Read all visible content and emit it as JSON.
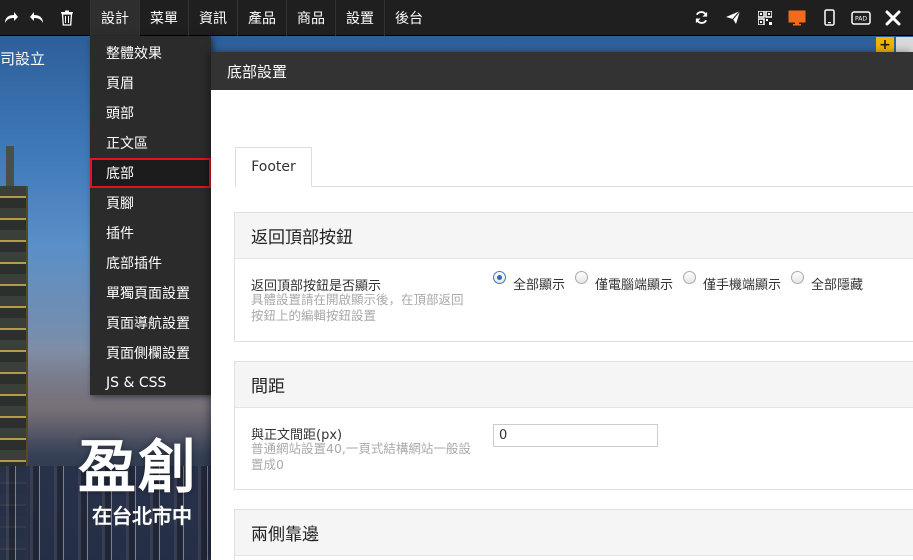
{
  "toolbar": {
    "left_icons": [
      "redo-icon",
      "undo-icon",
      "trash-icon"
    ],
    "menu": [
      "設計",
      "菜單",
      "資訊",
      "產品",
      "商品",
      "設置",
      "後台"
    ],
    "right_icons": [
      "refresh-icon",
      "send-icon",
      "qrcode-icon",
      "desktop-icon",
      "mobile-icon",
      "pad-icon",
      "close-icon"
    ],
    "pad_label": "PAD",
    "accent_color": "#f26b1d"
  },
  "dropdown": {
    "items": [
      "整體效果",
      "頁眉",
      "頭部",
      "正文區",
      "底部",
      "頁腳",
      "插件",
      "底部插件",
      "單獨頁面設置",
      "頁面導航設置",
      "頁面側欄設置",
      "JS & CSS"
    ],
    "selected": "底部",
    "highlight_color": "#e0141e"
  },
  "background": {
    "brand_fragment": "司設立",
    "hero_title": "盈創",
    "hero_subtitle": "在台北市中"
  },
  "panel": {
    "title": "底部設置",
    "tab": "Footer",
    "sections": [
      {
        "title": "返回頂部按鈕",
        "label": "返回頂部按鈕是否顯示",
        "help": "具體設置請在開啟顯示後，在頂部返回按鈕上的編輯按鈕設置",
        "options": [
          "全部顯示",
          "僅電腦端顯示",
          "僅手機端顯示",
          "全部隱藏"
        ],
        "selected": "全部顯示"
      },
      {
        "title": "間距",
        "label": "與正文間距(px)",
        "help": "普通網站設置40,一頁式結構網站一般設置成0",
        "value": "0"
      },
      {
        "title": "兩側靠邊"
      }
    ]
  }
}
